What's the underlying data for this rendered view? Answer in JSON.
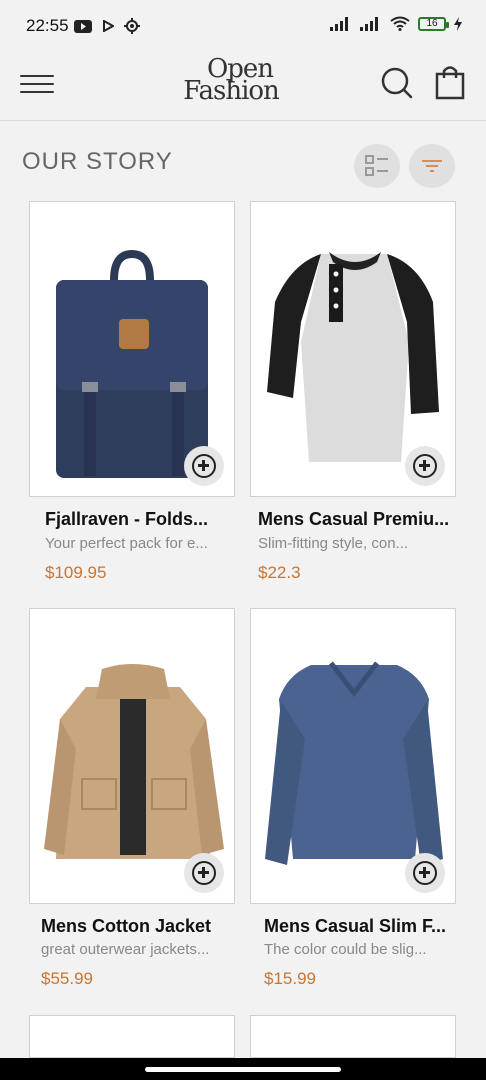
{
  "status": {
    "time": "22:55",
    "battery": "16"
  },
  "header": {
    "logo_line1": "Open",
    "logo_line2": "Fashion",
    "menu_icon": "hamburger-menu-icon",
    "search_icon": "search-icon",
    "bag_icon": "shopping-bag-icon"
  },
  "section": {
    "title": "OUR STORY"
  },
  "colors": {
    "price": "#c87533",
    "background": "#f2f2f2"
  },
  "products": [
    {
      "title": "Fjallraven - Folds...",
      "description": "Your perfect pack for e...",
      "price": "$109.95",
      "image": "backpack"
    },
    {
      "title": "Mens Casual Premiu...",
      "description": "Slim-fitting style, con...",
      "price": "$22.3",
      "image": "raglan-shirt"
    },
    {
      "title": "Mens Cotton Jacket",
      "description": "great outerwear jackets...",
      "price": "$55.99",
      "image": "jacket"
    },
    {
      "title": "Mens Casual Slim F...",
      "description": "The color could be slig...",
      "price": "$15.99",
      "image": "longsleeve-shirt"
    }
  ]
}
